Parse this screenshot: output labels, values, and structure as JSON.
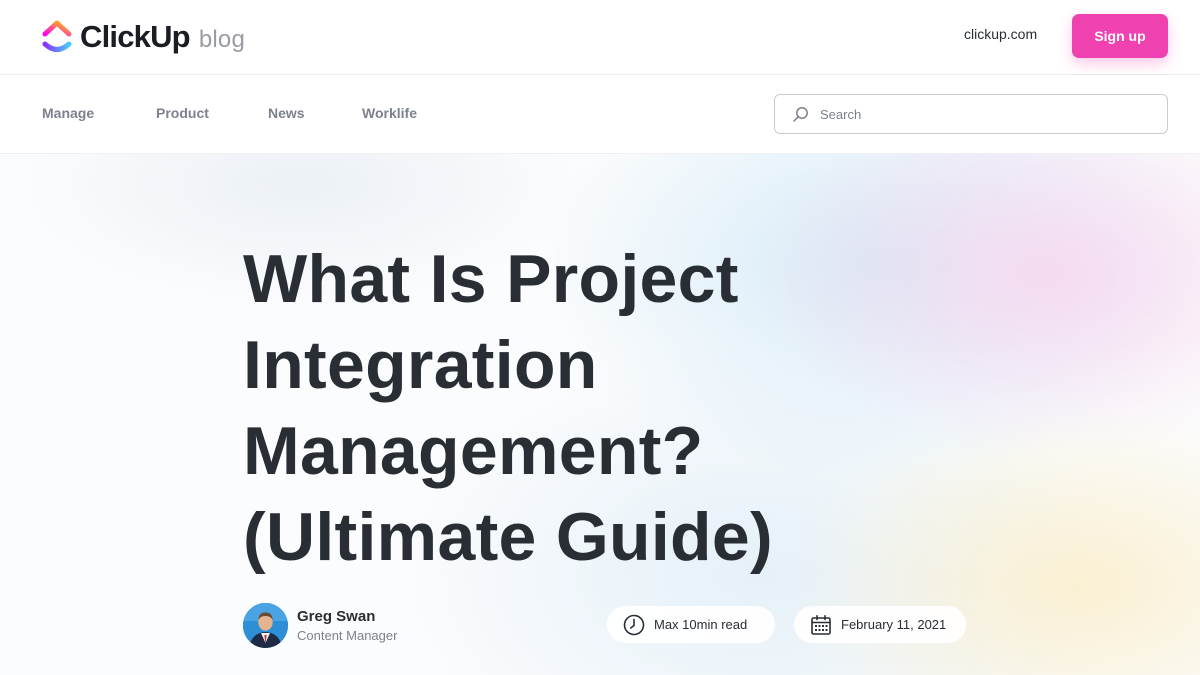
{
  "header": {
    "logo_text": "ClickUp",
    "logo_suffix": "blog",
    "site_link": "clickup.com",
    "signup_label": "Sign up",
    "accent_color": "#f041b1"
  },
  "nav": {
    "items": [
      {
        "label": "Manage"
      },
      {
        "label": "Product"
      },
      {
        "label": "News"
      },
      {
        "label": "Worklife"
      }
    ],
    "search": {
      "placeholder": "Search",
      "value": "",
      "icon": "search-icon"
    }
  },
  "article": {
    "title_lines": [
      "What Is Project",
      "Integration",
      "Management?",
      "(Ultimate Guide)"
    ],
    "author": {
      "name": "Greg Swan",
      "role": "Content Manager"
    },
    "read_time": "Max 10min read",
    "read_time_icon": "clock-icon",
    "date": "February 11, 2021",
    "date_icon": "calendar-icon"
  }
}
